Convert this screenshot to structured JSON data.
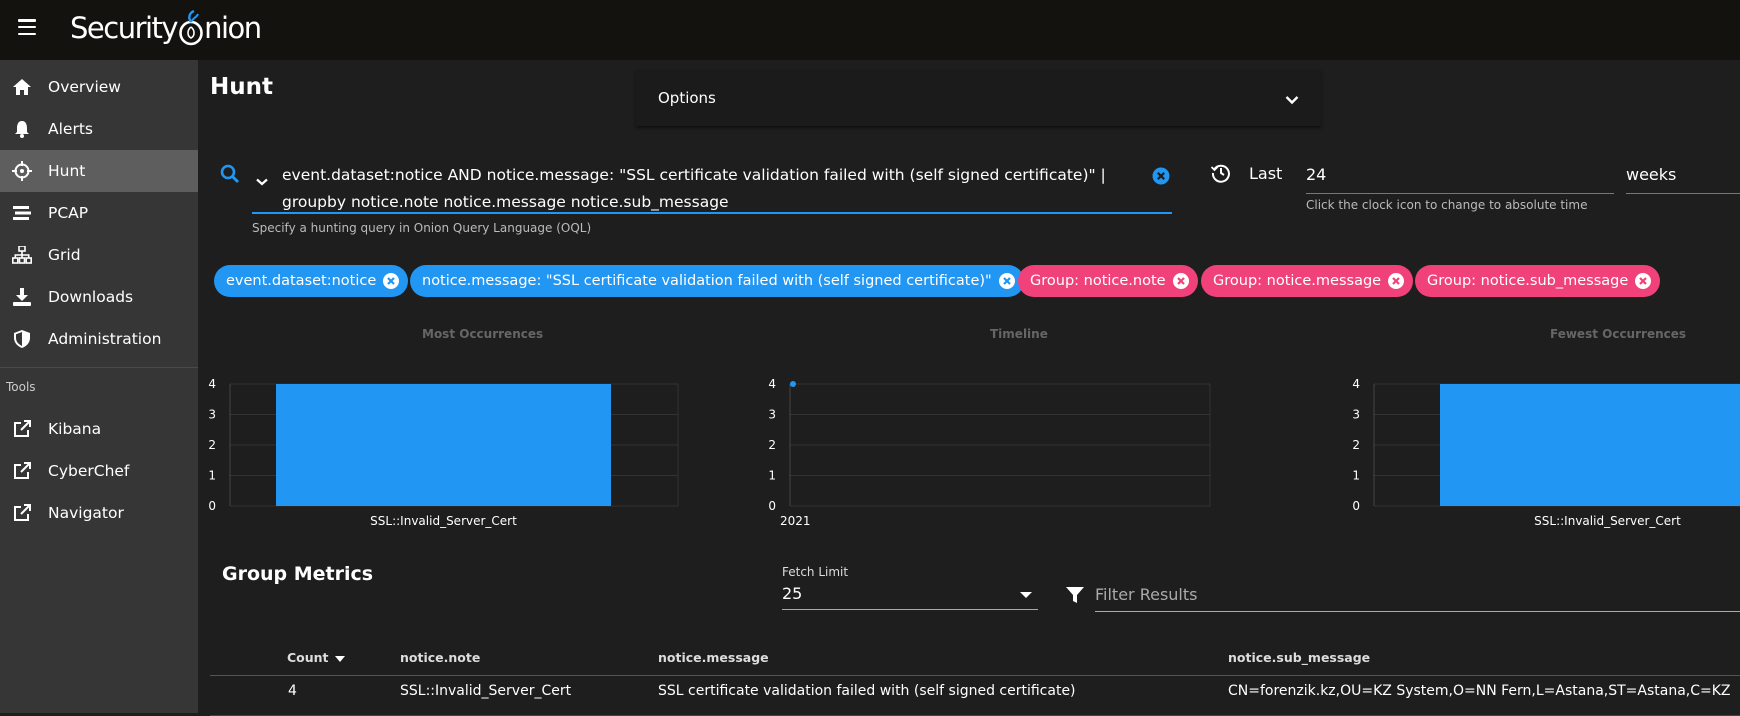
{
  "app": {
    "logo_text_a": "Security",
    "logo_text_b": "nion"
  },
  "sidebar": {
    "items": [
      {
        "label": "Overview",
        "icon": "home-icon"
      },
      {
        "label": "Alerts",
        "icon": "bell-icon"
      },
      {
        "label": "Hunt",
        "icon": "crosshairs-icon",
        "active": true
      },
      {
        "label": "PCAP",
        "icon": "stream-icon"
      },
      {
        "label": "Grid",
        "icon": "sitemap-icon"
      },
      {
        "label": "Downloads",
        "icon": "download-icon"
      },
      {
        "label": "Administration",
        "icon": "shield-icon"
      }
    ],
    "tools_label": "Tools",
    "tools": [
      {
        "label": "Kibana",
        "icon": "external-link-icon"
      },
      {
        "label": "CyberChef",
        "icon": "external-link-icon"
      },
      {
        "label": "Navigator",
        "icon": "external-link-icon"
      }
    ]
  },
  "main": {
    "title": "Hunt",
    "options_label": "Options",
    "query": {
      "text": "event.dataset:notice AND notice.message: \"SSL certificate validation failed with (self signed certificate)\" | groupby notice.note notice.message notice.sub_message",
      "hint": "Specify a hunting query in Onion Query Language (OQL)"
    },
    "time": {
      "last_label": "Last",
      "value": "24",
      "units": "weeks",
      "hint": "Click the clock icon to change to absolute time"
    },
    "chips": [
      {
        "label": "event.dataset:notice",
        "color": "blue"
      },
      {
        "label": "notice.message: \"SSL certificate validation failed with (self signed certificate)\"",
        "color": "blue"
      },
      {
        "label": "Group: notice.note",
        "color": "pink"
      },
      {
        "label": "Group: notice.message",
        "color": "pink"
      },
      {
        "label": "Group: notice.sub_message",
        "color": "pink"
      }
    ]
  },
  "colors": {
    "accent": "#2196f3",
    "group_chip": "#f0417b",
    "sidebar_bg": "#363636",
    "topbar_bg": "#13120f"
  },
  "chart_data": [
    {
      "type": "bar",
      "title": "Most Occurrences",
      "categories": [
        "SSL::Invalid_Server_Cert"
      ],
      "values": [
        4
      ],
      "ylim": [
        0,
        4
      ],
      "yticks": [
        0,
        1,
        2,
        3,
        4
      ]
    },
    {
      "type": "line",
      "title": "Timeline",
      "x": [
        "2021"
      ],
      "values": [
        4
      ],
      "ylim": [
        0,
        4
      ],
      "yticks": [
        0,
        1,
        2,
        3,
        4
      ]
    },
    {
      "type": "bar",
      "title": "Fewest Occurrences",
      "categories": [
        "SSL::Invalid_Server_Cert"
      ],
      "values": [
        4
      ],
      "ylim": [
        0,
        4
      ],
      "yticks": [
        0,
        1,
        2,
        3,
        4
      ]
    }
  ],
  "metrics": {
    "title": "Group Metrics",
    "fetch_limit_label": "Fetch Limit",
    "fetch_limit_value": "25",
    "filter_placeholder": "Filter Results",
    "columns": [
      "Count",
      "notice.note",
      "notice.message",
      "notice.sub_message"
    ],
    "rows": [
      [
        "4",
        "SSL::Invalid_Server_Cert",
        "SSL certificate validation failed with (self signed certificate)",
        "CN=forenzik.kz,OU=KZ System,O=NN Fern,L=Astana,ST=Astana,C=KZ"
      ]
    ]
  }
}
